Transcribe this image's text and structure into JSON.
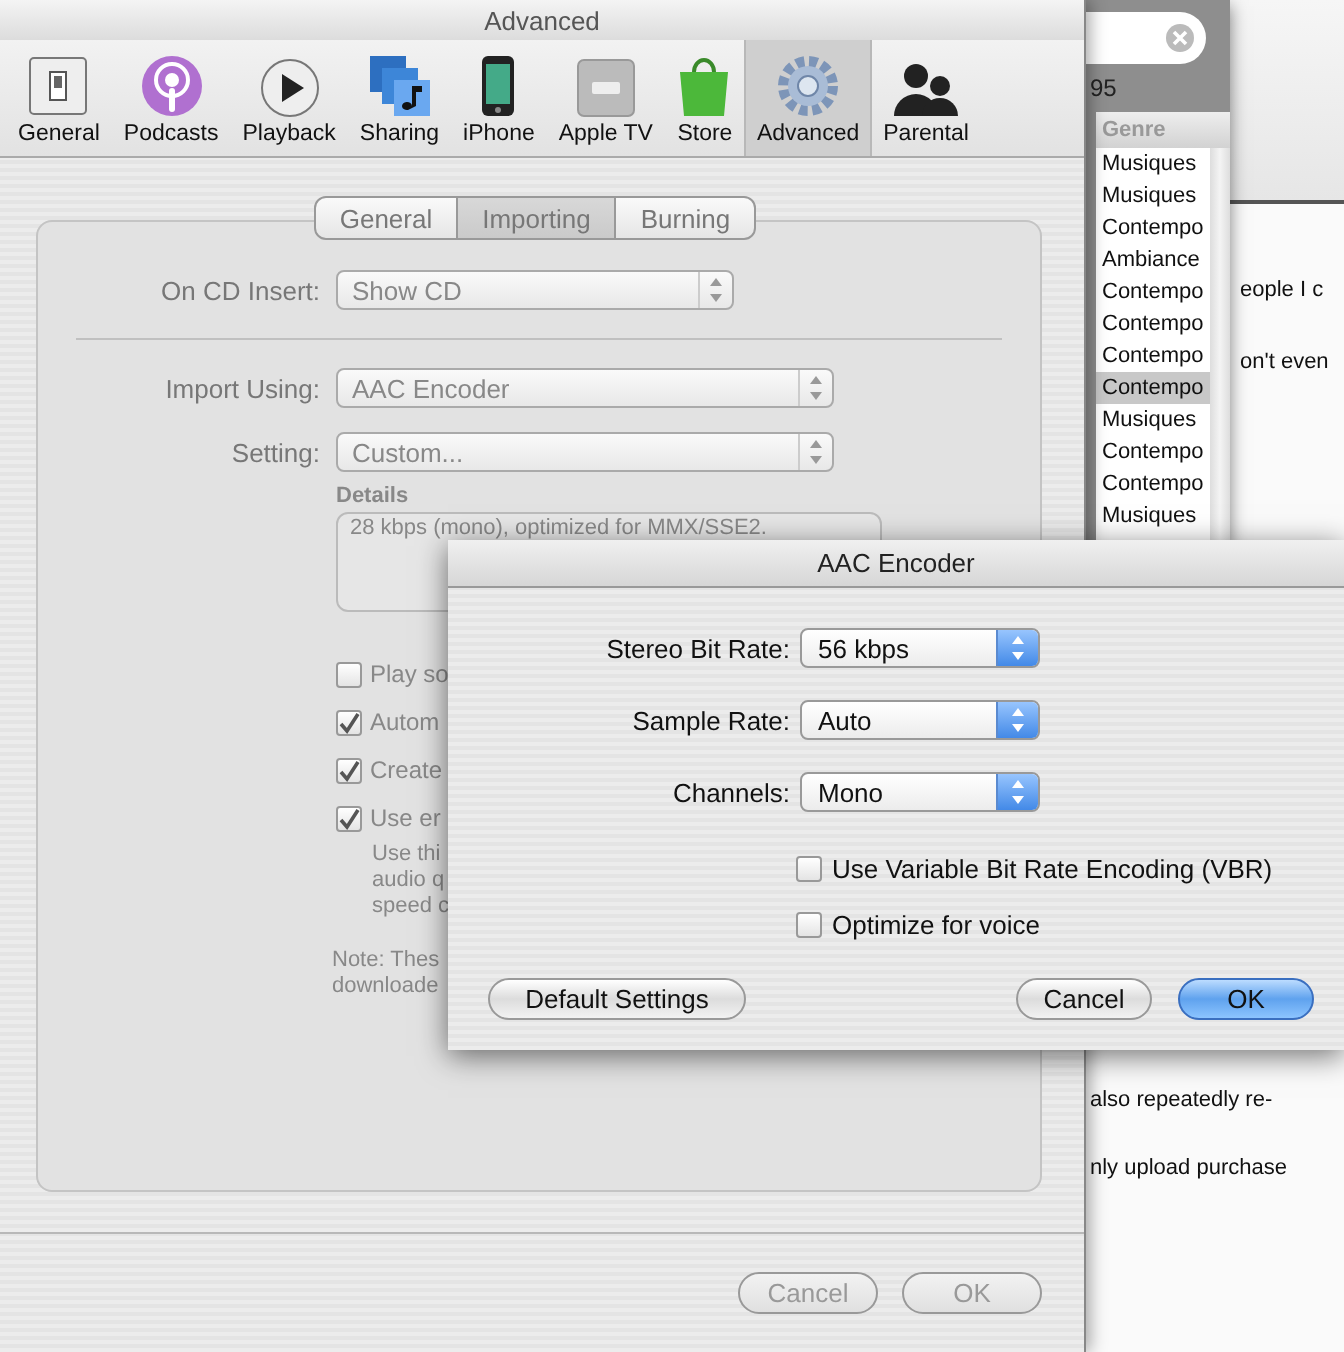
{
  "prefs_window": {
    "title": "Advanced",
    "toolbar": [
      {
        "label": "General",
        "kind": "switch",
        "selected": false
      },
      {
        "label": "Podcasts",
        "kind": "podcast",
        "selected": false
      },
      {
        "label": "Playback",
        "kind": "play",
        "selected": false
      },
      {
        "label": "Sharing",
        "kind": "sharing",
        "selected": false
      },
      {
        "label": "iPhone",
        "kind": "phone",
        "selected": false
      },
      {
        "label": "Apple TV",
        "kind": "tv",
        "selected": false
      },
      {
        "label": "Store",
        "kind": "bag",
        "selected": false
      },
      {
        "label": "Advanced",
        "kind": "gear",
        "selected": true
      },
      {
        "label": "Parental",
        "kind": "people",
        "selected": false
      }
    ],
    "tabs": [
      {
        "label": "General",
        "selected": false
      },
      {
        "label": "Importing",
        "selected": true
      },
      {
        "label": "Burning",
        "selected": false
      }
    ],
    "on_cd_insert": {
      "label": "On CD Insert:",
      "value": "Show CD"
    },
    "import_using": {
      "label": "Import Using:",
      "value": "AAC Encoder"
    },
    "setting": {
      "label": "Setting:",
      "value": "Custom..."
    },
    "details": {
      "label": "Details",
      "text": "28 kbps (mono), optimized for MMX/SSE2."
    },
    "options": [
      {
        "label": "Play so",
        "checked": false
      },
      {
        "label": "Autom",
        "checked": true
      },
      {
        "label": "Create",
        "checked": true
      },
      {
        "label": "Use er",
        "checked": true
      }
    ],
    "help_lines": [
      "Use thi",
      "audio q",
      "speed c"
    ],
    "note_lines": [
      "Note: Thes",
      "downloade"
    ],
    "buttons": [
      {
        "label": "Cancel",
        "disabled": true
      },
      {
        "label": "OK",
        "disabled": true
      }
    ]
  },
  "encoder_dialog": {
    "title": "AAC Encoder",
    "fields": [
      {
        "label": "Stereo Bit Rate:",
        "value": "56 kbps"
      },
      {
        "label": "Sample Rate:",
        "value": "Auto"
      },
      {
        "label": "Channels:",
        "value": "Mono"
      }
    ],
    "options": [
      {
        "label": "Use Variable Bit Rate Encoding (VBR)",
        "checked": false
      },
      {
        "label": "Optimize for voice",
        "checked": false
      }
    ],
    "buttons": [
      {
        "label": "Default Settings",
        "kind": "normal"
      },
      {
        "label": "Cancel",
        "kind": "normal"
      },
      {
        "label": "OK",
        "kind": "default"
      }
    ]
  },
  "music_window": {
    "count": "95",
    "column_header": "Genre",
    "genres": [
      {
        "text": "Musiques",
        "selected": false
      },
      {
        "text": "Musiques",
        "selected": false
      },
      {
        "text": "Contempo",
        "selected": false
      },
      {
        "text": "Ambiance",
        "selected": false
      },
      {
        "text": "Contempo",
        "selected": false
      },
      {
        "text": "Contempo",
        "selected": false
      },
      {
        "text": "Contempo",
        "selected": false
      },
      {
        "text": "Contempo",
        "selected": true
      },
      {
        "text": "Musiques",
        "selected": false
      },
      {
        "text": "Contempo",
        "selected": false
      },
      {
        "text": "Contempo",
        "selected": false
      },
      {
        "text": "Musiques",
        "selected": false
      }
    ]
  },
  "web_page": {
    "top_lines": [
      "eople I c",
      "on't even"
    ],
    "bottom_lines": [
      "also repeatedly re-",
      "nly upload purchase"
    ]
  }
}
